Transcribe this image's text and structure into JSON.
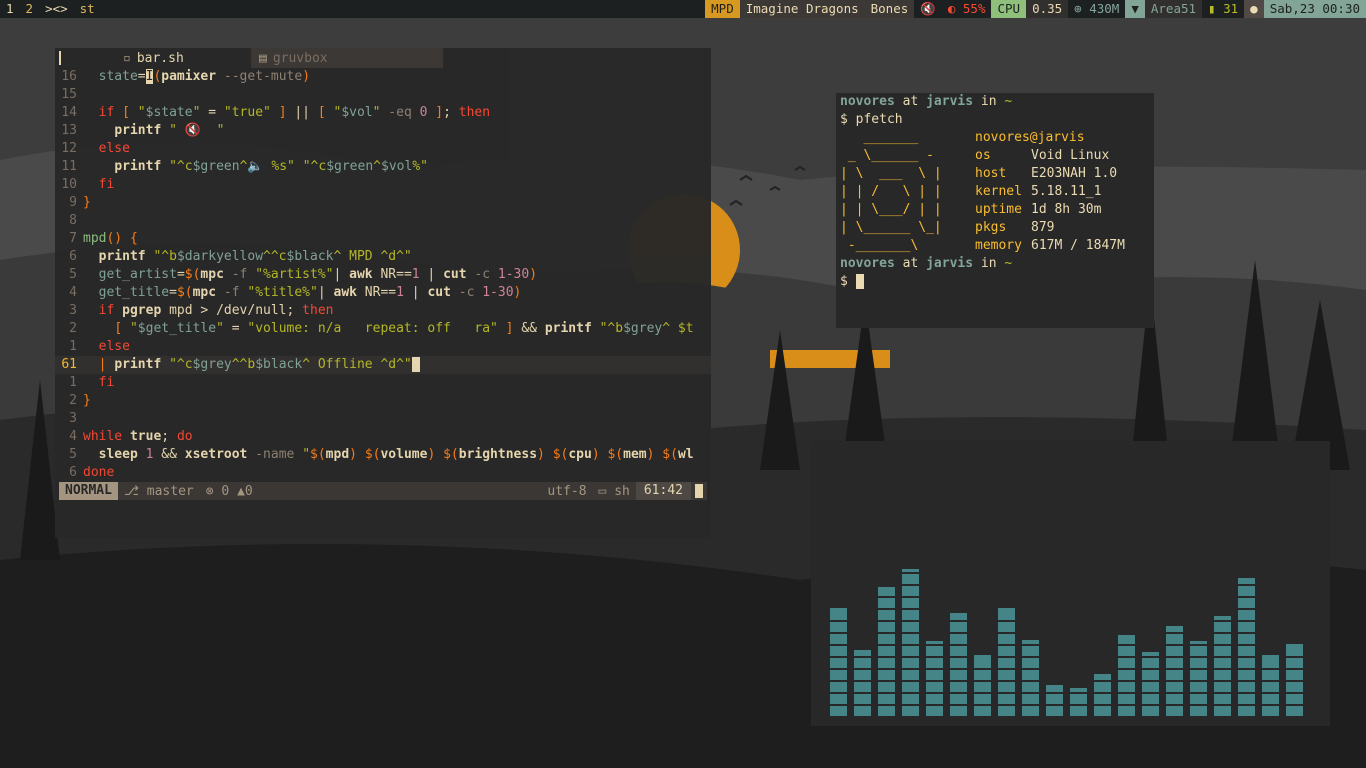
{
  "colors": {
    "bar_bg": "#1d2021",
    "accent_yellow": "#d79921",
    "accent_aqua": "#8ec07c",
    "accent_blue": "#83a598",
    "editor_bg": "#282828",
    "viz_bar": "#458588"
  },
  "topbar": {
    "tags": [
      "1",
      "2"
    ],
    "layout": "><>",
    "title": "st",
    "mpd_label": "MPD",
    "mpd_artist": "Imagine Dragons",
    "mpd_title": "Bones",
    "volume_icon": "🔇",
    "brightness": "55%",
    "cpu_label": "CPU",
    "cpu_value": "0.35",
    "mem_value": "430M",
    "wifi_name": "Area51",
    "battery": "31",
    "clock": "Sab,23 00:30"
  },
  "editor": {
    "tabs": [
      "bar.sh",
      "gruvbox"
    ],
    "lines": [
      {
        "n": "16",
        "html": "  <span class='v'>state</span>=<span class='cursorblock'>I</span><span class='o'>(</span><span class='c'>pamixer</span> <span class='g'>--get-mute</span><span class='o'>)</span>"
      },
      {
        "n": "15",
        "html": ""
      },
      {
        "n": "14",
        "html": "  <span class='k'>if</span> <span class='o'>[</span> <span class='s'>\"<span class='v'>$state</span>\"</span> = <span class='s'>\"true\"</span> <span class='o'>]</span> || <span class='o'>[</span> <span class='s'>\"<span class='v'>$vol</span>\"</span> <span class='g'>-eq</span> <span class='n'>0</span> <span class='o'>]</span>; <span class='k'>then</span>"
      },
      {
        "n": "13",
        "html": "    <span class='c'>printf</span> <span class='s'>\" 🔇  \"</span>"
      },
      {
        "n": "12",
        "html": "  <span class='k'>else</span>"
      },
      {
        "n": "11",
        "html": "    <span class='c'>printf</span> <span class='s'>\"^c<span class='v'>$green</span>^🔈 %s\"</span> <span class='s'>\"^c<span class='v'>$green</span>^<span class='v'>$vol</span>%\"</span>"
      },
      {
        "n": "10",
        "html": "  <span class='k'>fi</span>"
      },
      {
        "n": "9",
        "html": "<span class='o'>}</span>"
      },
      {
        "n": "8",
        "html": ""
      },
      {
        "n": "7",
        "html": "<span class='f'>mpd</span><span class='o'>()</span> <span class='o'>{</span>"
      },
      {
        "n": "6",
        "html": "  <span class='c'>printf</span> <span class='s'>\"^b<span class='v'>$darkyellow</span>^^c<span class='v'>$black</span>^ MPD ^d^\"</span>"
      },
      {
        "n": "5",
        "html": "  <span class='v'>get_artist</span>=<span class='o'>$(</span><span class='c'>mpc</span> <span class='g'>-f</span> <span class='s'>\"%artist%\"</span>| <span class='c'>awk</span> NR==<span class='n'>1</span> | <span class='c'>cut</span> <span class='g'>-c</span> <span class='n'>1-30</span><span class='o'>)</span>"
      },
      {
        "n": "4",
        "html": "  <span class='v'>get_title</span>=<span class='o'>$(</span><span class='c'>mpc</span> <span class='g'>-f</span> <span class='s'>\"%title%\"</span>| <span class='c'>awk</span> NR==<span class='n'>1</span> | <span class='c'>cut</span> <span class='g'>-c</span> <span class='n'>1-30</span><span class='o'>)</span>"
      },
      {
        "n": "3",
        "html": "  <span class='k'>if</span> <span class='c'>pgrep</span> mpd > /dev/null; <span class='k'>then</span>"
      },
      {
        "n": "2",
        "html": "    <span class='o'>[</span> <span class='s'>\"<span class='v'>$get_title</span>\"</span> = <span class='s'>\"volume: n/a   repeat: off   ra\"</span> <span class='o'>]</span> && <span class='c'>printf</span> <span class='s'>\"^b<span class='v'>$grey</span>^ $t</span>"
      },
      {
        "n": "1",
        "html": "  <span class='k'>else</span>"
      },
      {
        "n": "61",
        "html": "  <span class='o'>|</span> <span class='c'>printf</span> <span class='s'>\"^c<span class='v'>$grey</span>^^b<span class='v'>$black</span>^ Offline ^d^\"</span><span class='cursorblock'> </span>",
        "current": true
      },
      {
        "n": "1",
        "html": "  <span class='k'>fi</span>"
      },
      {
        "n": "2",
        "html": "<span class='o'>}</span>"
      },
      {
        "n": "3",
        "html": ""
      },
      {
        "n": "4",
        "html": "<span class='k'>while</span> <span class='c'>true</span>; <span class='k'>do</span>"
      },
      {
        "n": "5",
        "html": "  <span class='c'>sleep</span> <span class='n'>1</span> && <span class='c'>xsetroot</span> <span class='g'>-name</span> <span class='s'>\"<span class='o'>$(</span><span class='c'>mpd</span><span class='o'>)</span> <span class='o'>$(</span><span class='c'>volume</span><span class='o'>)</span> <span class='o'>$(</span><span class='c'>brightness</span><span class='o'>)</span> <span class='o'>$(</span><span class='c'>cpu</span><span class='o'>)</span> <span class='o'>$(</span><span class='c'>mem</span><span class='o'>)</span> <span class='o'>$(</span><span class='c'>wl</span></span>"
      },
      {
        "n": "6",
        "html": "<span class='k'>done</span>"
      }
    ],
    "status": {
      "mode": "NORMAL",
      "branch": "master",
      "errors": "0",
      "warnings": "0",
      "encoding": "utf-8",
      "filetype": "sh",
      "position": "61:42"
    }
  },
  "terminal": {
    "user": "novores",
    "at": "at",
    "host": "jarvis",
    "in": "in",
    "dir": "~",
    "command": "pfetch",
    "prompt": "$",
    "logo": [
      "   _______",
      " _ \\______ -",
      "| \\  ___  \\ |",
      "| | /   \\ | |",
      "| | \\___/ | |",
      "| \\______ \\_|",
      " -_______\\"
    ],
    "userhost": "novores@jarvis",
    "info": [
      {
        "key": "os",
        "value": "Void Linux"
      },
      {
        "key": "host",
        "value": "E203NAH 1.0"
      },
      {
        "key": "kernel",
        "value": "5.18.11_1"
      },
      {
        "key": "uptime",
        "value": "1d 8h 30m"
      },
      {
        "key": "pkgs",
        "value": "879"
      },
      {
        "key": "memory",
        "value": "617M / 1847M"
      }
    ]
  },
  "visualizer": {
    "levels": [
      0.73,
      0.45,
      0.87,
      0.99,
      0.51,
      0.7,
      0.42,
      0.73,
      0.52,
      0.22,
      0.2,
      0.29,
      0.55,
      0.44,
      0.61,
      0.51,
      0.68,
      0.93,
      0.42,
      0.49
    ]
  }
}
